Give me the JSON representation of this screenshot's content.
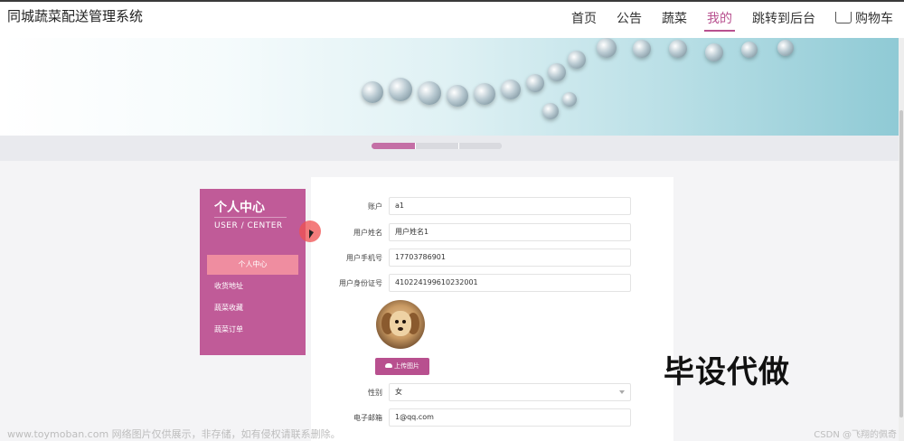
{
  "header": {
    "site_title": "同城蔬菜配送管理系统",
    "nav": [
      "首页",
      "公告",
      "蔬菜",
      "我的",
      "跳转到后台"
    ],
    "active_nav": "我的",
    "cart_label": "购物车"
  },
  "sidebar": {
    "title": "个人中心",
    "subtitle": "USER / CENTER",
    "items": [
      "个人中心",
      "收货地址",
      "蔬菜收藏",
      "蔬菜订单"
    ]
  },
  "form": {
    "account": {
      "label": "账户",
      "value": "a1"
    },
    "name": {
      "label": "用户姓名",
      "value": "用户姓名1"
    },
    "phone": {
      "label": "用户手机号",
      "value": "17703786901"
    },
    "id_card": {
      "label": "用户身份证号",
      "value": "410224199610232001"
    },
    "upload_label": "上传图片",
    "gender": {
      "label": "性别",
      "value": "女"
    },
    "email": {
      "label": "电子邮箱",
      "value": "1@qq.com"
    }
  },
  "overlay": {
    "text": "毕设代做"
  },
  "watermarks": {
    "left": "www.toymoban.com 网络图片仅供展示，非存储，如有侵权请联系删除。",
    "right": "CSDN @飞翔的佩奇"
  },
  "colors": {
    "accent": "#b8508f",
    "sidebar": "#c05b98",
    "sidebar_active": "#ef8da0"
  }
}
